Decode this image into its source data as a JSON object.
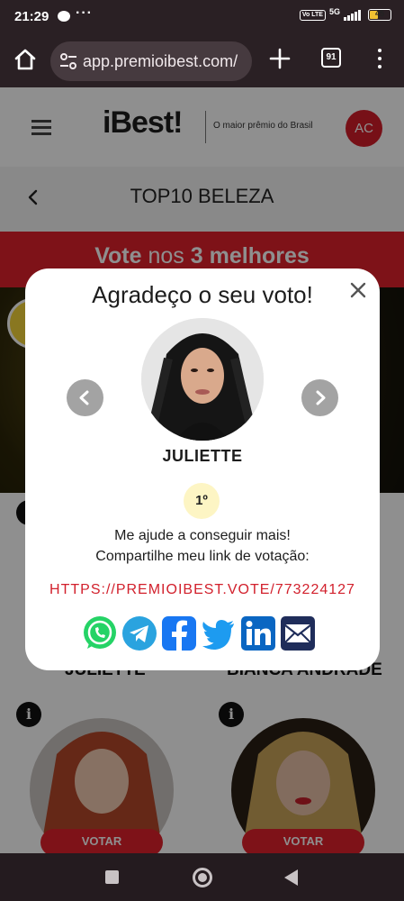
{
  "status_bar": {
    "time": "21:29",
    "network": "5G",
    "volte": "Vo LTE",
    "battery": "45",
    "battery_level": 0.45
  },
  "browser": {
    "url": "app.premioibest.com/",
    "tab_count": "91"
  },
  "site": {
    "logo": "iBest!",
    "tagline": "O maior prêmio do Brasil",
    "user_initials": "AC",
    "category_title": "TOP10 BELEZA",
    "vote_banner": {
      "part1": "Vote",
      "part2": "nos",
      "part3": "3 melhores"
    },
    "candidates": [
      {
        "name": "JULIETTE",
        "vote_label": "VOTAR"
      },
      {
        "name": "BIANCA ANDRADE",
        "vote_label": "VOTAR"
      }
    ]
  },
  "modal": {
    "title": "Agradeço o seu voto!",
    "candidate_name": "JULIETTE",
    "rank": "1º",
    "help_line1": "Me ajude a conseguir mais!",
    "help_line2": "Compartilhe meu link de votação:",
    "vote_link": "HTTPS://PREMIOIBEST.VOTE/773224127",
    "share_icons": [
      "whatsapp-icon",
      "telegram-icon",
      "facebook-icon",
      "twitter-icon",
      "linkedin-icon",
      "email-icon"
    ]
  },
  "colors": {
    "brand_red": "#e0202c",
    "logo_yellow": "#f5d31c",
    "rank_badge": "#fdf5c4",
    "whatsapp": "#25d366",
    "telegram": "#2aa3df",
    "facebook": "#1877f2",
    "twitter": "#1d9bf0",
    "linkedin": "#0a66c2",
    "email": "#1f2d5a"
  }
}
